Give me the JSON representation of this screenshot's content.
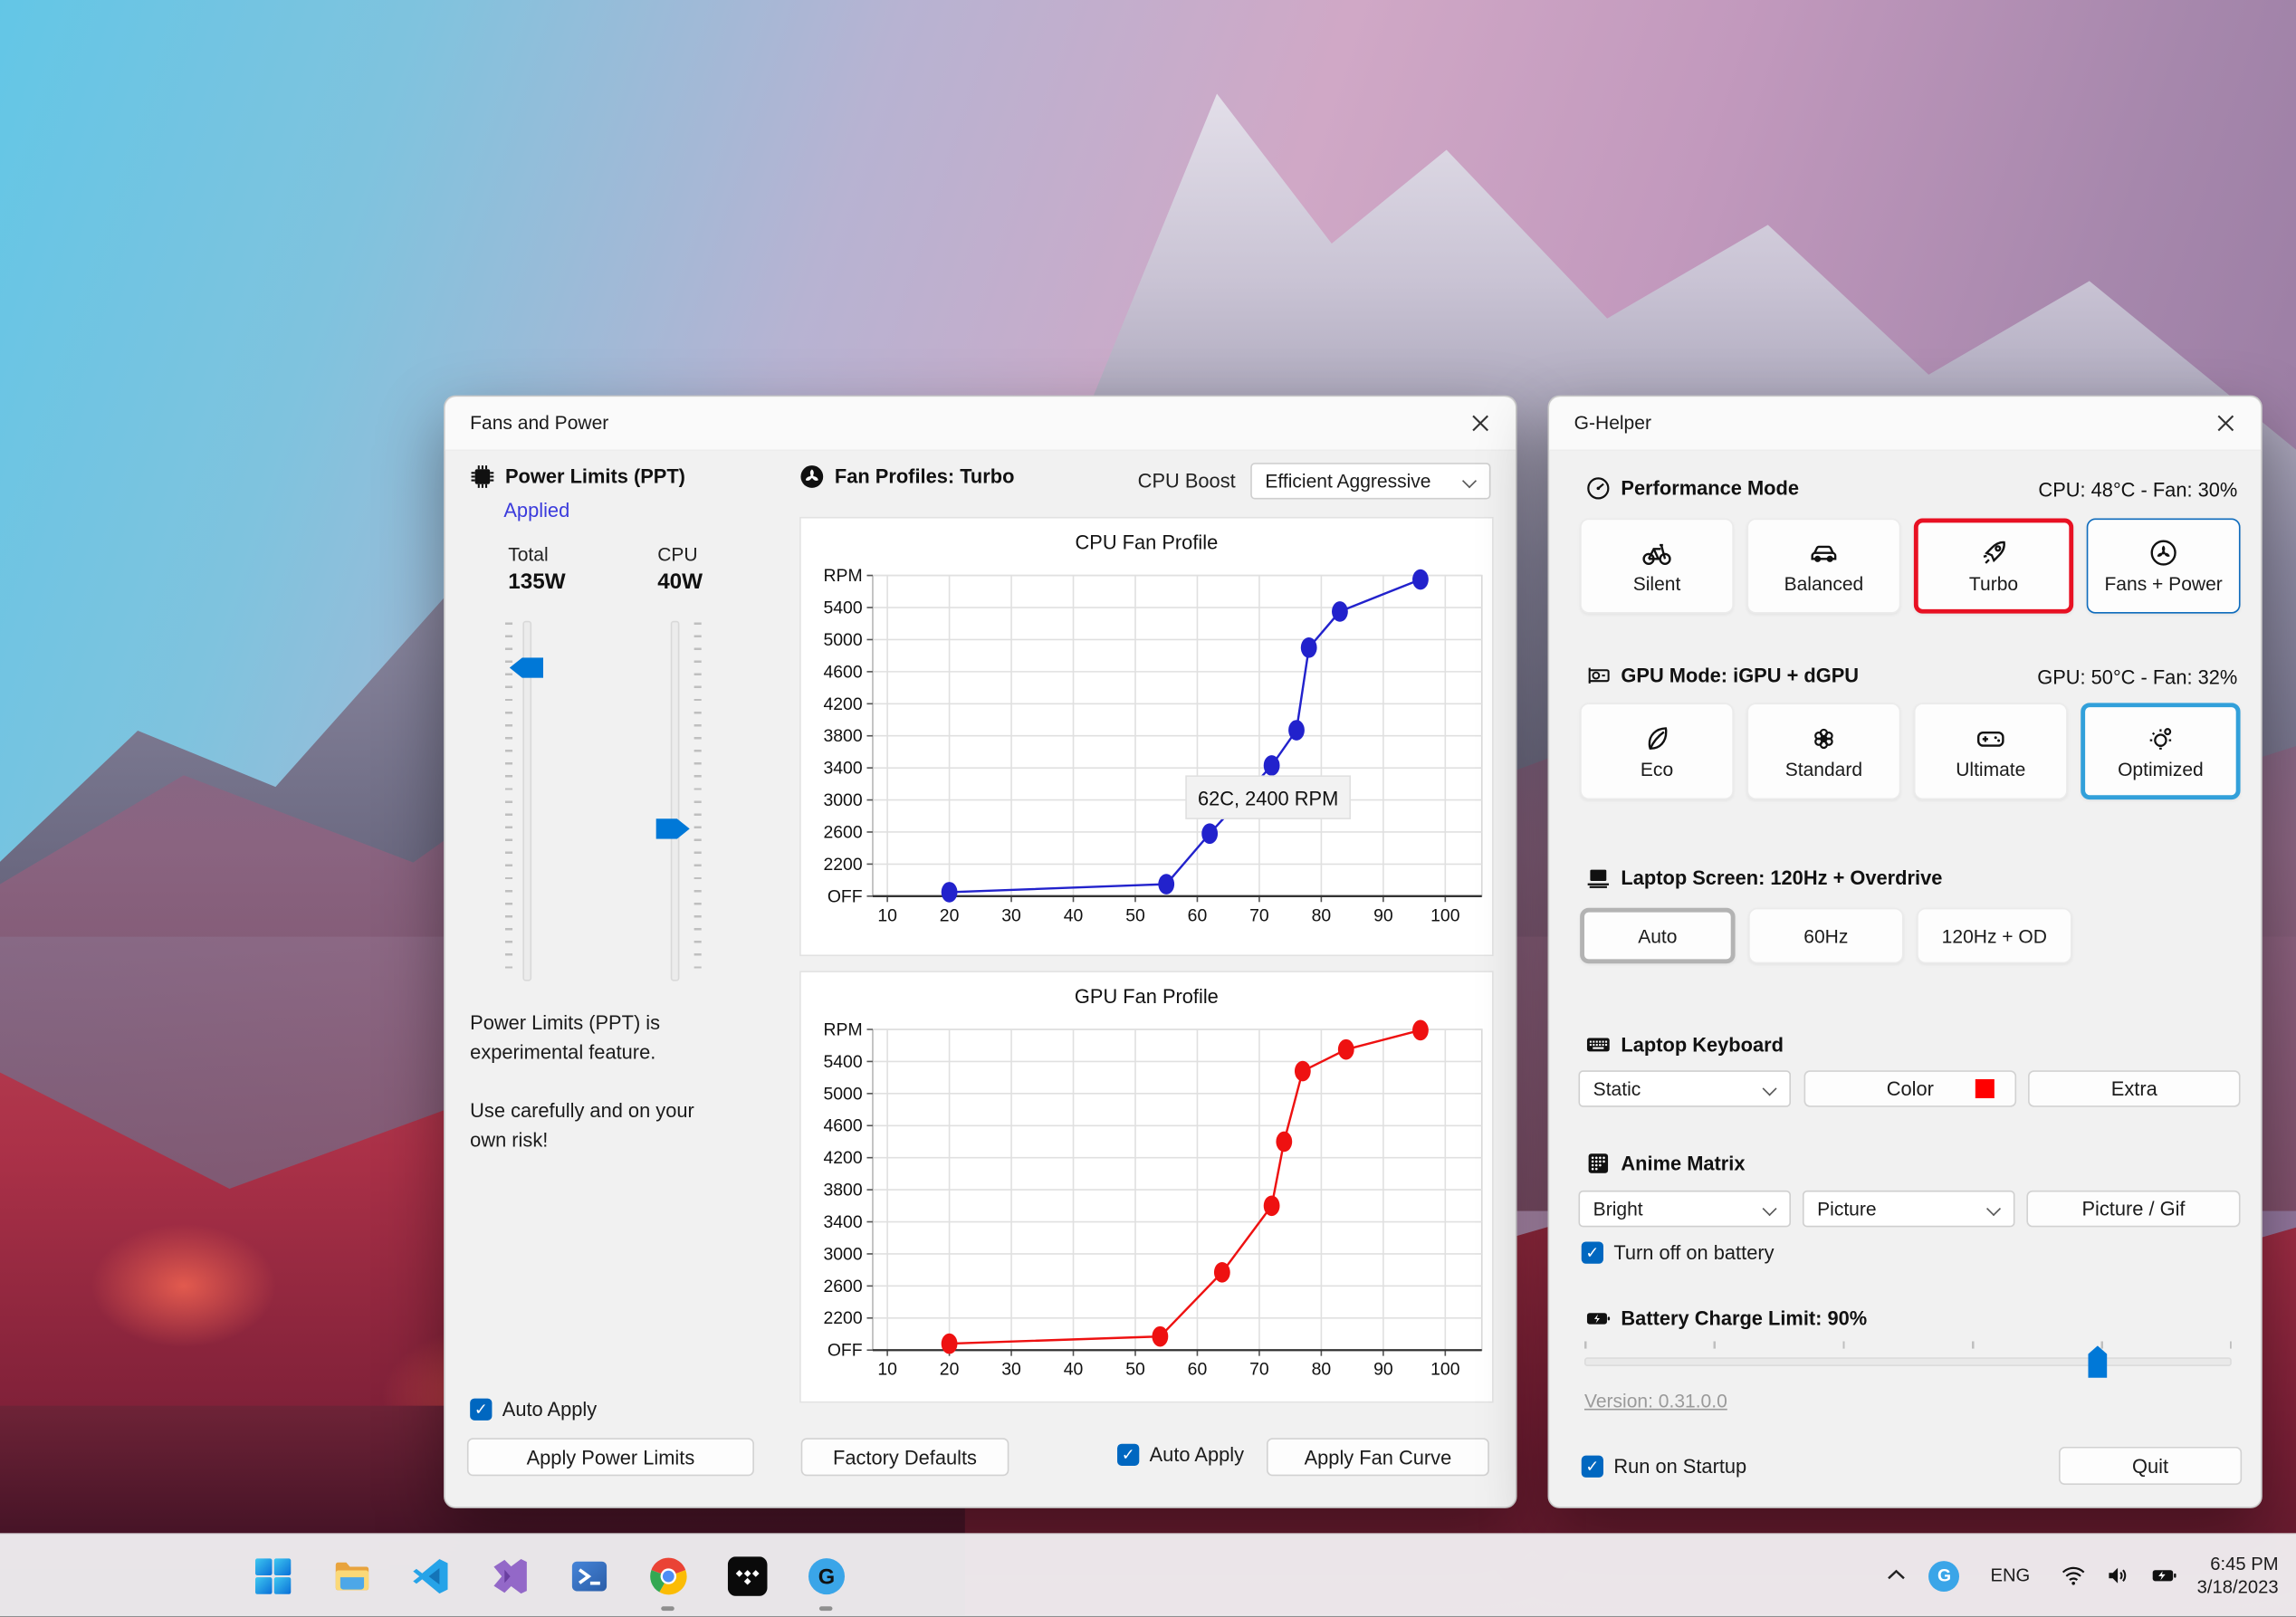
{
  "colors": {
    "accent": "#0067c0",
    "applied_blue": "#3b3bdc",
    "turbo_border": "#e81123",
    "fans_power_border": "#0f6cbd",
    "optimized_border": "#32a0da",
    "keyboard_swatch": "#ff0000",
    "cpu_series": "#2222cc",
    "gpu_series": "#ee1111"
  },
  "window_fans": {
    "title": "Fans and Power",
    "power_limits": {
      "heading": "Power Limits (PPT)",
      "status": "Applied",
      "total_label": "Total",
      "total_value": "135W",
      "cpu_label": "CPU",
      "cpu_value": "40W",
      "note1": "Power Limits (PPT) is experimental feature.",
      "note2": "Use carefully and on your own risk!",
      "auto_apply_label": "Auto Apply",
      "apply_button": "Apply Power Limits"
    },
    "fan_profiles": {
      "heading": "Fan Profiles: Turbo",
      "cpu_boost_label": "CPU Boost",
      "cpu_boost_value": "Efficient Aggressive",
      "factory_defaults_button": "Factory Defaults",
      "auto_apply_label": "Auto Apply",
      "apply_button": "Apply Fan Curve"
    }
  },
  "window_ghelper": {
    "title": "G-Helper",
    "performance": {
      "heading": "Performance Mode",
      "status": "CPU: 48°C - Fan: 30%",
      "modes": [
        {
          "label": "Silent",
          "icon": "bicycle"
        },
        {
          "label": "Balanced",
          "icon": "car"
        },
        {
          "label": "Turbo",
          "icon": "rocket",
          "selected": "red"
        },
        {
          "label": "Fans + Power",
          "icon": "fanmode",
          "selected": "blue"
        }
      ]
    },
    "gpu_mode": {
      "heading": "GPU Mode: iGPU + dGPU",
      "status": "GPU: 50°C - Fan: 32%",
      "modes": [
        {
          "label": "Eco",
          "icon": "leaf"
        },
        {
          "label": "Standard",
          "icon": "flower"
        },
        {
          "label": "Ultimate",
          "icon": "gamepad"
        },
        {
          "label": "Optimized",
          "icon": "bulb",
          "selected": "lightblue"
        }
      ]
    },
    "screen": {
      "heading": "Laptop Screen: 120Hz + Overdrive",
      "modes": [
        {
          "label": "Auto",
          "selected": "gray"
        },
        {
          "label": "60Hz"
        },
        {
          "label": "120Hz + OD"
        }
      ]
    },
    "keyboard": {
      "heading": "Laptop Keyboard",
      "mode_value": "Static",
      "color_button": "Color",
      "extra_button": "Extra"
    },
    "matrix": {
      "heading": "Anime Matrix",
      "brightness_value": "Bright",
      "running_value": "Picture",
      "picture_button": "Picture / Gif",
      "battery_checkbox": "Turn off on battery"
    },
    "battery": {
      "heading": "Battery Charge Limit: 90%",
      "percent": 90
    },
    "version": "Version: 0.31.0.0",
    "run_on_startup": "Run on Startup",
    "quit_button": "Quit"
  },
  "taskbar": {
    "icons": [
      {
        "name": "start"
      },
      {
        "name": "file-explorer"
      },
      {
        "name": "vscode"
      },
      {
        "name": "visual-studio"
      },
      {
        "name": "powershell"
      },
      {
        "name": "chrome",
        "running": true
      },
      {
        "name": "tidal"
      },
      {
        "name": "g-helper",
        "running": true
      }
    ],
    "tray": {
      "language": "ENG",
      "time": "6:45 PM",
      "date": "3/18/2023"
    }
  },
  "chart_data": [
    {
      "type": "line",
      "title": "CPU Fan Profile",
      "ylabel": "RPM",
      "series_color": "#2222cc",
      "xticks": [
        10,
        20,
        30,
        40,
        50,
        60,
        70,
        80,
        90,
        100
      ],
      "ytick_labels": [
        "OFF",
        "2200",
        "2600",
        "3000",
        "3400",
        "3800",
        "4200",
        "4600",
        "5000",
        "5400"
      ],
      "xlim": [
        10,
        100
      ],
      "grid": true,
      "points": [
        [
          20,
          1850
        ],
        [
          55,
          1950
        ],
        [
          62,
          2580
        ],
        [
          72,
          3430
        ],
        [
          76,
          3870
        ],
        [
          78,
          4900
        ],
        [
          83,
          5350
        ],
        [
          96,
          5750
        ]
      ],
      "tooltip": "62C, 2400 RPM"
    },
    {
      "type": "line",
      "title": "GPU Fan Profile",
      "ylabel": "RPM",
      "series_color": "#ee1111",
      "xticks": [
        10,
        20,
        30,
        40,
        50,
        60,
        70,
        80,
        90,
        100
      ],
      "ytick_labels": [
        "OFF",
        "2200",
        "2600",
        "3000",
        "3400",
        "3800",
        "4200",
        "4600",
        "5000",
        "5400"
      ],
      "xlim": [
        10,
        100
      ],
      "grid": true,
      "points": [
        [
          20,
          1880
        ],
        [
          54,
          1970
        ],
        [
          64,
          2770
        ],
        [
          72,
          3600
        ],
        [
          74,
          4400
        ],
        [
          77,
          5280
        ],
        [
          84,
          5550
        ],
        [
          96,
          5790
        ]
      ]
    }
  ]
}
